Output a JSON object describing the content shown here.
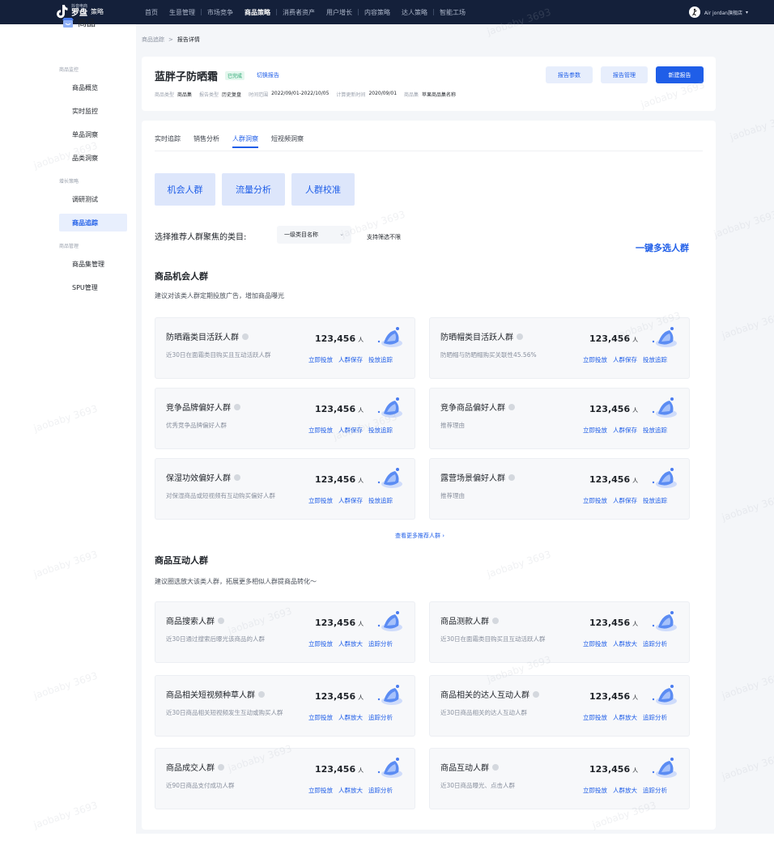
{
  "topnav": {
    "logo_small": "抖音电商",
    "logo_main": "罗盘",
    "logo_sub": "策略",
    "items": [
      "首页",
      "生意管理",
      "市场竞争",
      "商品策略",
      "消费者资产",
      "用户增长",
      "内容策略",
      "达人策略",
      "智能工场"
    ],
    "active_index": 3,
    "user_name": "Air jordan旗舰店",
    "user_caret": "▾"
  },
  "sidebar": {
    "title": "商品",
    "groups": [
      {
        "label": "商品监控",
        "items": [
          "商品概览",
          "实时监控",
          "单品洞察",
          "品类洞察"
        ]
      },
      {
        "label": "增长策略",
        "items": [
          "调研测试",
          "商品追踪"
        ]
      },
      {
        "label": "商品管理",
        "items": [
          "商品集管理",
          "SPU管理"
        ]
      }
    ],
    "active_item": "商品追踪"
  },
  "breadcrumb": {
    "parent": "商品追踪",
    "sep": ">",
    "current": "报告详情"
  },
  "report": {
    "title": "蓝胖子防晒霜",
    "status_tag": "已完成",
    "switch_label": "切换报告",
    "meta": [
      {
        "k": "商品类型",
        "v": "商品集"
      },
      {
        "k": "报告类型",
        "v": "历史复盘"
      },
      {
        "k": "时间范围",
        "v": "2022/09/01-2022/10/05"
      },
      {
        "k": "计算更新时间",
        "v": "2020/09/01"
      },
      {
        "k": "商品集",
        "v": "苹果商品集名称"
      }
    ],
    "buttons": {
      "params": "报告参数",
      "manage": "报告管理",
      "create": "新建报告"
    }
  },
  "tabs": [
    "实时追踪",
    "销售分析",
    "人群洞察",
    "短视频洞察"
  ],
  "active_tab": 2,
  "segments": [
    "机会人群",
    "流量分析",
    "人群校准"
  ],
  "filter": {
    "label": "选择推荐人群聚焦的类目:",
    "select_value": "一级类目名称",
    "chevron": "⌄",
    "note": "支持筛选不限",
    "multi_select": "一键多选人群"
  },
  "opportunity": {
    "title": "商品机会人群",
    "desc": "建议对该类人群定期投放广告，增加商品曝光",
    "cards": [
      {
        "title": "防晒霜类目活跃人群",
        "desc": "近30日在面霜类目购买且互动活跃人群",
        "num": "123,456",
        "unit": "人",
        "actions": [
          "立即投放",
          "人群保存",
          "投放追踪"
        ]
      },
      {
        "title": "防晒帽类目活跃人群",
        "desc": "防晒帽与防晒帽购买关联性45.56%",
        "num": "123,456",
        "unit": "人",
        "actions": [
          "立即投放",
          "人群保存",
          "投放追踪"
        ]
      },
      {
        "title": "竞争品牌偏好人群",
        "desc": "优秀竞争品牌偏好人群",
        "num": "123,456",
        "unit": "人",
        "actions": [
          "立即投放",
          "人群保存",
          "投放追踪"
        ]
      },
      {
        "title": "竞争商品偏好人群",
        "desc": "推荐理由",
        "num": "123,456",
        "unit": "人",
        "actions": [
          "立即投放",
          "人群保存",
          "投放追踪"
        ]
      },
      {
        "title": "保湿功效偏好人群",
        "desc": "对保湿商品或短视频有互动购买偏好人群",
        "num": "123,456",
        "unit": "人",
        "actions": [
          "立即投放",
          "人群保存",
          "投放追踪"
        ]
      },
      {
        "title": "露营场景偏好人群",
        "desc": "推荐理由",
        "num": "123,456",
        "unit": "人",
        "actions": [
          "立即投放",
          "人群保存",
          "投放追踪"
        ]
      }
    ],
    "more_link": "查看更多推荐人群 ›"
  },
  "interaction": {
    "title": "商品互动人群",
    "desc": "建议圈选放大该类人群，拓展更多相似人群提商品转化～",
    "cards": [
      {
        "title": "商品搜索人群",
        "desc": "近30日通过搜索后曝光该商品的人群",
        "num": "123,456",
        "unit": "人",
        "actions": [
          "立即投放",
          "人群放大",
          "追踪分析"
        ]
      },
      {
        "title": "商品测款人群",
        "desc": "近30日在面霜类目购买且互动活跃人群",
        "num": "123,456",
        "unit": "人",
        "actions": [
          "立即投放",
          "人群放大",
          "追踪分析"
        ]
      },
      {
        "title": "商品相关短视频种草人群",
        "desc": "近30日商品相关短视频发生互动或购买人群",
        "num": "123,456",
        "unit": "人",
        "actions": [
          "立即投放",
          "人群放大",
          "追踪分析"
        ]
      },
      {
        "title": "商品相关的达人互动人群",
        "desc": "近30日商品相关的达人互动人群",
        "num": "123,456",
        "unit": "人",
        "actions": [
          "立即投放",
          "人群放大",
          "追踪分析"
        ]
      },
      {
        "title": "商品成交人群",
        "desc": "近90日商品支付成功人群",
        "num": "123,456",
        "unit": "人",
        "actions": [
          "立即投放",
          "人群放大",
          "追踪分析"
        ]
      },
      {
        "title": "商品互动人群",
        "desc": "近30日商品曝光、点击人群",
        "num": "123,456",
        "unit": "人",
        "actions": [
          "立即投放",
          "人群放大",
          "追踪分析"
        ]
      }
    ]
  },
  "watermark_text": "jaobaby 3693",
  "colors": {
    "accent": "#1f5ee8",
    "nav_bg": "#14203a",
    "segment_bg": "#dde6fb",
    "page_bg": "#f4f6f9"
  }
}
